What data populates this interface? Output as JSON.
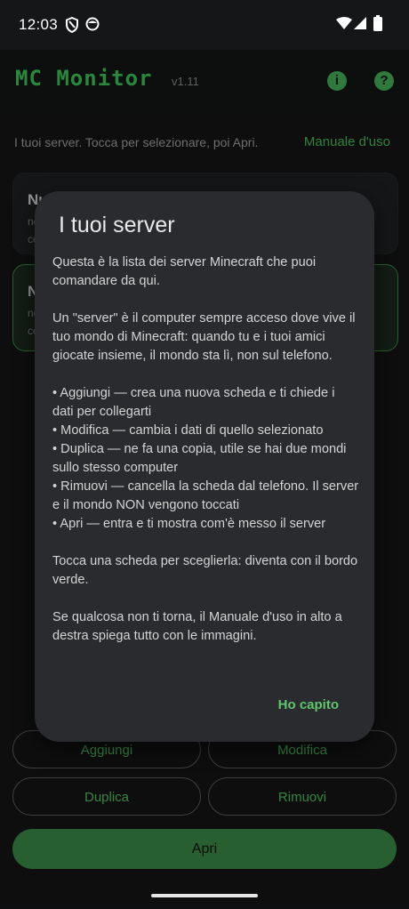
{
  "status_bar": {
    "time": "12:03"
  },
  "header": {
    "title": "MC Monitor",
    "version": "v1.11",
    "info_label": "i",
    "help_label": "?"
  },
  "intro": {
    "hint": "I tuoi server. Tocca per selezionare, poi Apri.",
    "manual_link": "Manuale d'uso"
  },
  "server_cards": [
    {
      "name": "Nu",
      "sub_line1": "ne",
      "sub_line2": "cc"
    },
    {
      "name": "N",
      "sub_line1": "ne",
      "sub_line2": "co"
    }
  ],
  "actions": {
    "add": "Aggiungi",
    "edit": "Modifica",
    "duplicate": "Duplica",
    "remove": "Rimuovi",
    "open": "Apri"
  },
  "dialog": {
    "title": "I tuoi server",
    "p1": "Questa è la lista dei server Minecraft che puoi comandare da qui.",
    "p2": "Un \"server\" è il computer sempre acceso dove vive il tuo mondo di Minecraft: quando tu e i tuoi amici giocate insieme, il mondo sta lì, non sul telefono.",
    "bullets": [
      "• Aggiungi — crea una nuova scheda e ti chiede i dati per collegarti",
      "• Modifica — cambia i dati di quello selezionato",
      "• Duplica — ne fa una copia, utile se hai due mondi sullo stesso computer",
      "• Rimuovi — cancella la scheda dal telefono. Il server e il mondo NON vengono toccati",
      "• Apri — entra e ti mostra com'è messo il server"
    ],
    "p3": "Tocca una scheda per sceglierla: diventa con il bordo verde.",
    "p4": "Se qualcosa non ti torna, il Manuale d'uso in alto a destra spiega tutto con le immagini.",
    "confirm": "Ho capito"
  },
  "colors": {
    "accent": "#3ec95b",
    "background": "#151617",
    "dialog": "#2a2b2e"
  }
}
